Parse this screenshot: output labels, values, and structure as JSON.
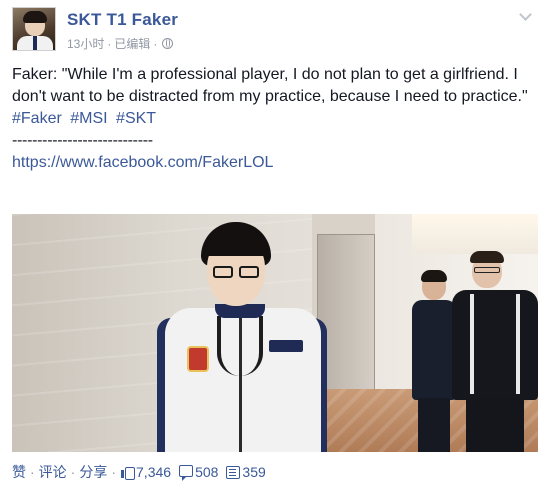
{
  "post": {
    "page_name": "SKT T1 Faker",
    "time": "13小时",
    "edited": "已编辑",
    "meta_separator": "·",
    "body_text": "Faker: \"While I'm a professional player, I do not plan to get a girlfriend. I don't want to be distracted from my practice, because I need to practice.\"",
    "hashtags": [
      "#Faker",
      "#MSI",
      "#SKT"
    ],
    "divider": "----------------------------",
    "link": "https://www.facebook.com/FakerLOL"
  },
  "actions": {
    "like_label": "赞",
    "comment_label": "评论",
    "share_label": "分享",
    "separator": "·",
    "likes_count": "7,346",
    "comments_count": "508",
    "shares_count": "359"
  },
  "icons": {
    "privacy": "globe-icon",
    "options": "chevron-down-icon",
    "likes": "thumbs-up-icon",
    "comments": "comment-icon",
    "shares": "share-icon"
  },
  "colors": {
    "link_blue": "#3b5998",
    "meta_gray": "#9197a3",
    "text": "#141823"
  }
}
